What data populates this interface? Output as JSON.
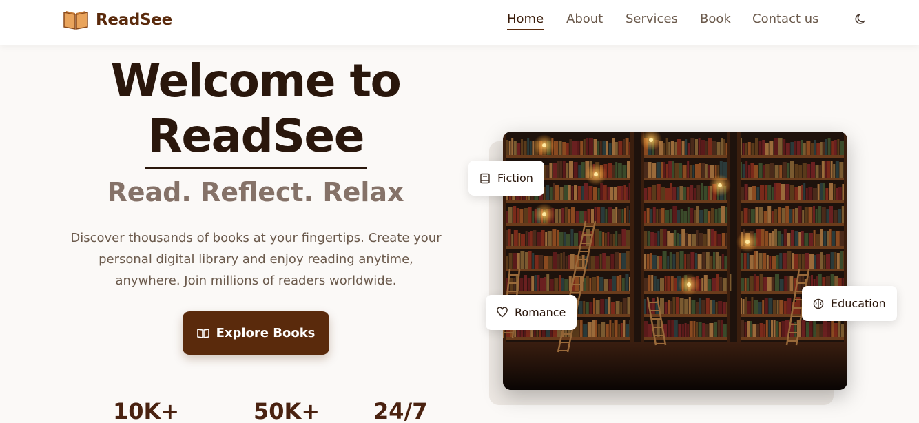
{
  "brand": {
    "name": "ReadSee"
  },
  "nav": {
    "links": [
      {
        "label": "Home",
        "active": true
      },
      {
        "label": "About"
      },
      {
        "label": "Services"
      },
      {
        "label": "Book"
      },
      {
        "label": "Contact us"
      }
    ],
    "theme_icon": "moon-icon"
  },
  "hero": {
    "title_line1": "Welcome to",
    "title_line2": "ReadSee",
    "tagline": "Read. Reflect. Relax",
    "description": "Discover thousands of books at your fingertips. Create your personal digital library and enjoy reading anytime, anywhere. Join millions of readers worldwide.",
    "cta_label": "Explore Books",
    "cta_icon": "open-book-icon"
  },
  "stats": [
    {
      "value": "10K+"
    },
    {
      "value": "50K+"
    },
    {
      "value": "24/7"
    }
  ],
  "chips": {
    "fiction": {
      "label": "Fiction",
      "icon": "book-icon"
    },
    "romance": {
      "label": "Romance",
      "icon": "heart-icon"
    },
    "education": {
      "label": "Education",
      "icon": "brain-icon"
    }
  },
  "colors": {
    "brand": "#5a2a0c",
    "background": "#fbf9f7",
    "heading": "#2a170c",
    "muted": "#857268"
  }
}
